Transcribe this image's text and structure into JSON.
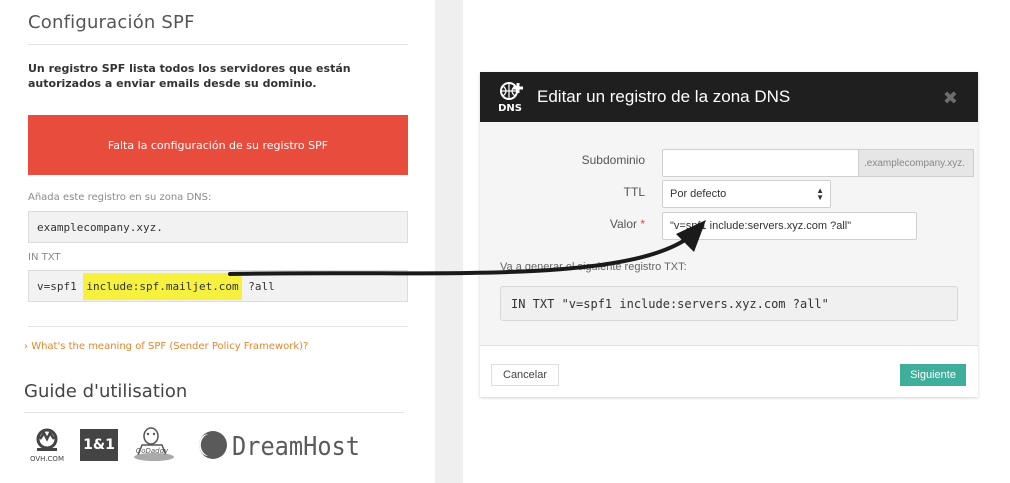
{
  "spf": {
    "title": "Configuración SPF",
    "intro": "Un registro SPF lista todos los servidores que están autorizados a enviar emails desde su dominio.",
    "alert": "Falta la configuración de su registro SPF",
    "add_label": "Añada este registro en su zona DNS:",
    "domain_value": "examplecompany.xyz.",
    "record_type_label": "IN TXT",
    "record_prefix": "v=spf1 ",
    "record_highlight": "include:spf.mailjet.com",
    "record_suffix": " ?all",
    "meaning_link": "What's the meaning of SPF (Sender Policy Framework)?",
    "meaning_chevron": "›"
  },
  "guide": {
    "title": "Guide d'utilisation",
    "providers": [
      {
        "name": "OVH.COM"
      },
      {
        "name": "1&1"
      },
      {
        "name": "GoDaddy"
      },
      {
        "name": "DreamHost"
      }
    ]
  },
  "modal": {
    "title": "Editar un registro de la zona DNS",
    "icon_label": "DNS",
    "close_glyph": "✖",
    "fields": {
      "subdomain_label": "Subdominio",
      "subdomain_value": "",
      "subdomain_suffix": ".examplecompany.xyz.",
      "ttl_label": "TTL",
      "ttl_value": "Por defecto",
      "value_label": "Valor",
      "value_required": "*",
      "value_value": "\"v=spf1 include:servers.xyz.com ?all\""
    },
    "generate_label": "Va a generar el siguiente registro TXT:",
    "generated_record": "IN TXT \"v=spf1 include:servers.xyz.com ?all\"",
    "cancel_label": "Cancelar",
    "next_label": "Siguiente"
  },
  "colors": {
    "alert": "#e84c3d",
    "highlight": "#f6f03f",
    "link": "#e5862c",
    "primary_button": "#3fae9a",
    "modal_header": "#1f1f1f"
  }
}
